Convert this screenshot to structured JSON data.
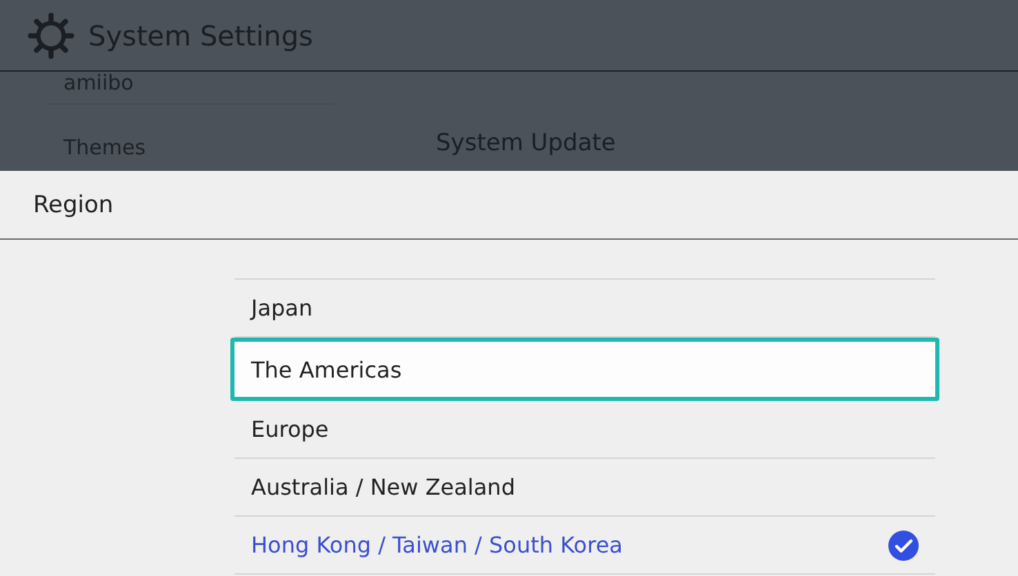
{
  "window": {
    "title": "System Settings"
  },
  "sidebar": {
    "items": [
      "amiibo",
      "Themes"
    ]
  },
  "main": {
    "title": "System Update"
  },
  "sheet": {
    "title": "Region",
    "options": [
      {
        "label": "Japan",
        "selected": false,
        "focused": false
      },
      {
        "label": "The Americas",
        "selected": false,
        "focused": true
      },
      {
        "label": "Europe",
        "selected": false,
        "focused": false
      },
      {
        "label": "Australia / New Zealand",
        "selected": false,
        "focused": false
      },
      {
        "label": "Hong Kong / Taiwan / South Korea",
        "selected": true,
        "focused": false
      }
    ]
  }
}
